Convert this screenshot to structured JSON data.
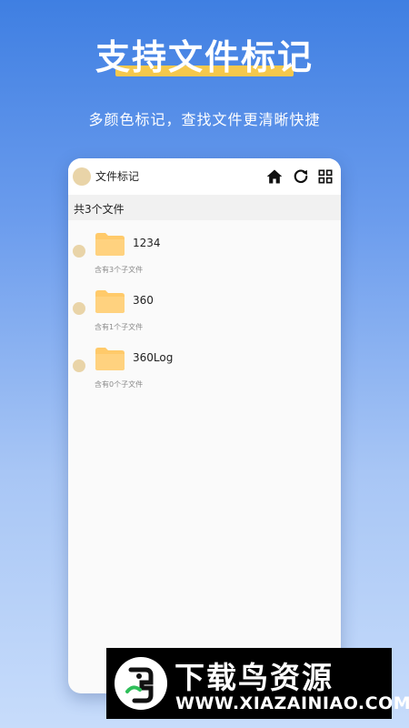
{
  "promo": {
    "title": "支持文件标记",
    "subtitle": "多颜色标记，查找文件更清晰快捷"
  },
  "app_bar": {
    "title": "文件标记",
    "icons": [
      "home-icon",
      "refresh-icon",
      "grid-icon"
    ]
  },
  "file_list": {
    "count_label": "共3个文件",
    "items": [
      {
        "name": "1234",
        "sub": "含有3个子文件"
      },
      {
        "name": "360",
        "sub": "含有1个子文件"
      },
      {
        "name": "360Log",
        "sub": "含有0个子文件"
      }
    ]
  },
  "watermark": {
    "name": "下载鸟资源",
    "url": "WWW.XIAZAINIAO.COM"
  },
  "colors": {
    "mark": "#e9d4a8",
    "folder": "#ffca6a",
    "highlight": "#f5c84c"
  }
}
